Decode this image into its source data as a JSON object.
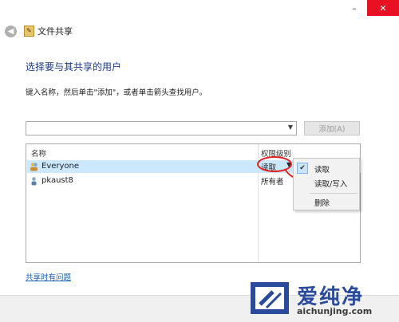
{
  "window": {
    "title": "文件共享",
    "min_label": "–",
    "close_label": "✕"
  },
  "heading": "选择要与其共享的用户",
  "instructions": "键入名称，然后单击\"添加\"，或者单击箭头查找用户。",
  "name_input": {
    "value": ""
  },
  "add_button": "添加(A)",
  "list": {
    "columns": [
      "名称",
      "权限级别"
    ],
    "rows": [
      {
        "name": "Everyone",
        "permission": "读取",
        "selected": true
      },
      {
        "name": "pkaust8",
        "permission": "所有者",
        "selected": false
      }
    ]
  },
  "menu": {
    "items": [
      {
        "label": "读取",
        "checked": true
      },
      {
        "label": "读取/写入",
        "checked": false
      },
      {
        "label": "删除",
        "checked": false
      }
    ]
  },
  "help_link": "共享时有问题",
  "watermark": {
    "cn": "爱纯净",
    "url": "aichunjing.com"
  },
  "colors": {
    "accent": "#1e3a8a",
    "highlight": "#e02020",
    "selection": "#cce8ff",
    "close": "#e81123"
  }
}
